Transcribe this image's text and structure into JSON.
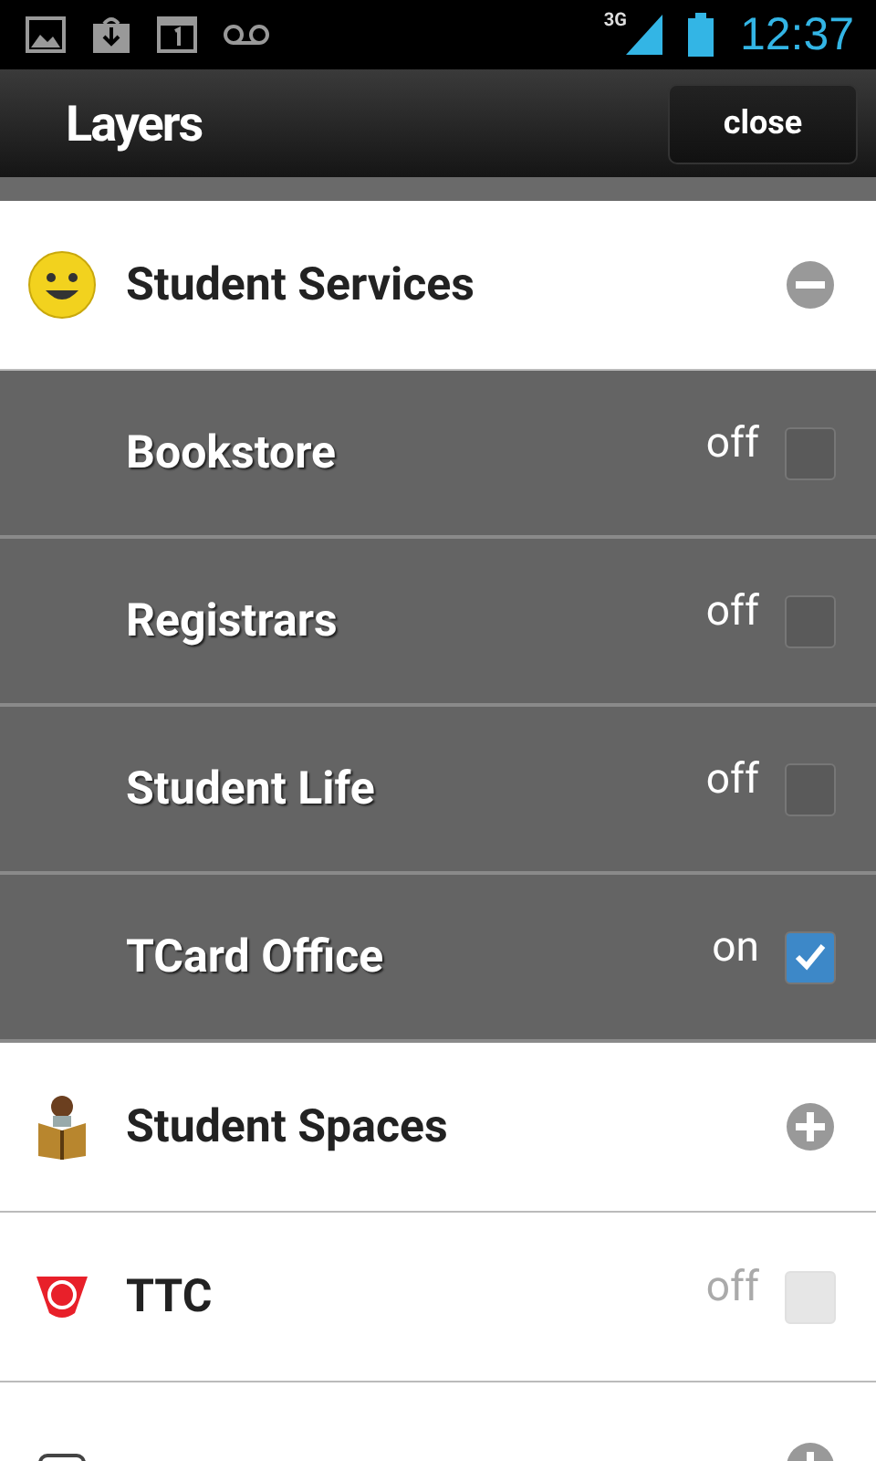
{
  "status_bar": {
    "network": "3G",
    "time": "12:37"
  },
  "action_bar": {
    "title": "Layers",
    "close_button": "close"
  },
  "layers": [
    {
      "kind": "group",
      "label": "Student Services",
      "expanded": true,
      "children": [
        {
          "label": "Bookstore",
          "state": "off",
          "checked": false
        },
        {
          "label": "Registrars",
          "state": "off",
          "checked": false
        },
        {
          "label": "Student Life",
          "state": "off",
          "checked": false
        },
        {
          "label": "TCard Office",
          "state": "on",
          "checked": true
        }
      ]
    },
    {
      "kind": "group",
      "label": "Student Spaces",
      "expanded": false
    },
    {
      "kind": "toggle",
      "label": "TTC",
      "state": "off",
      "checked": false
    },
    {
      "kind": "group",
      "expanded": false
    }
  ]
}
